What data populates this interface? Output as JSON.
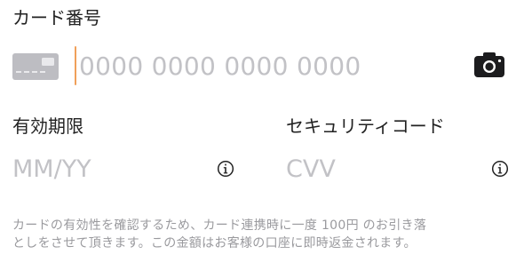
{
  "card_number": {
    "label": "カード番号",
    "placeholder": "0000 0000 0000 0000",
    "value": ""
  },
  "expiry": {
    "label": "有効期限",
    "placeholder": "MM/YY",
    "value": ""
  },
  "cvv": {
    "label": "セキュリティコード",
    "placeholder": "CVV",
    "value": ""
  },
  "notice": {
    "line1": "カードの有効性を確認するため、カード連携時に一度 100円 のお引き落",
    "line2": "としをさせて頂きます。この金額はお客様の口座に即時返金されます。"
  },
  "icons": {
    "card": "credit-card-icon",
    "camera": "camera-icon",
    "info": "info-icon"
  },
  "colors": {
    "caret": "#f0a05a",
    "placeholder": "#c2c2c6",
    "label": "#222222",
    "notice": "#9a9a9e"
  }
}
